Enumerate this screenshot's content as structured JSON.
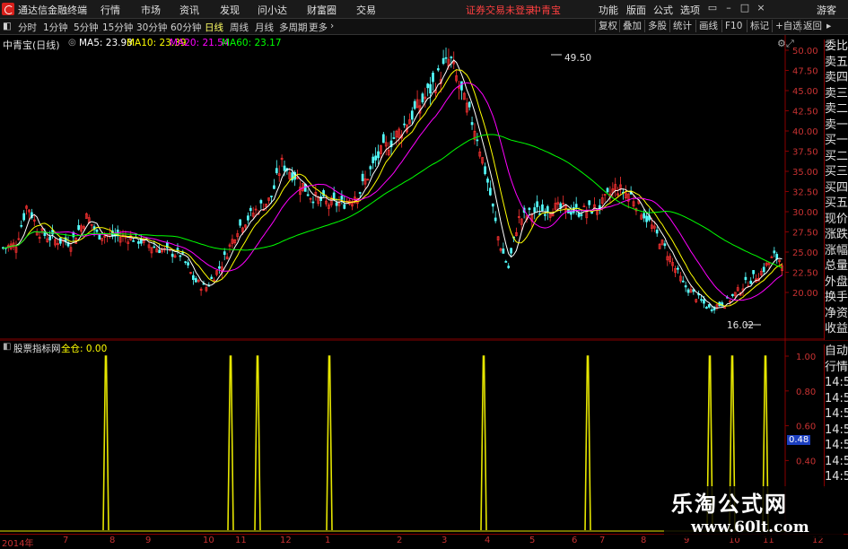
{
  "menubar": {
    "app_title": "通达信金融终端",
    "menus": [
      "行情",
      "市场",
      "资讯",
      "发现",
      "问小达",
      "财富圈",
      "交易"
    ],
    "login_notice": "证券交易未登录",
    "broker": "中青宝",
    "right_menus": [
      "功能",
      "版面",
      "公式",
      "选项"
    ],
    "guest": "游客"
  },
  "toolbar": {
    "periods": [
      "分时",
      "1分钟",
      "5分钟",
      "15分钟",
      "30分钟",
      "60分钟",
      "日线",
      "周线",
      "月线",
      "多周期",
      "更多"
    ],
    "active_period": "日线",
    "buttons": [
      "复权",
      "叠加",
      "多股",
      "统计",
      "画线",
      "F10",
      "标记",
      "+自选",
      "返回"
    ]
  },
  "main_chart": {
    "title": "中青宝(日线)",
    "ma_labels": [
      {
        "label": "MA5: 23.93",
        "color": "#ffffff"
      },
      {
        "label": "MA10: 23.39",
        "color": "#ffff00"
      },
      {
        "label": "MA20: 21.54",
        "color": "#ff00ff"
      },
      {
        "label": "MA60: 23.17",
        "color": "#00ff00"
      }
    ],
    "high_marker": "49.50",
    "low_marker": "16.02",
    "y_ticks": [
      "50.00",
      "47.50",
      "45.00",
      "42.50",
      "40.00",
      "37.50",
      "35.00",
      "32.50",
      "30.00",
      "27.50",
      "25.00",
      "22.50",
      "20.00"
    ]
  },
  "right_panel": [
    "委比",
    "卖五",
    "卖四",
    "卖三",
    "卖二",
    "卖一",
    "买一",
    "买二",
    "买三",
    "买四",
    "买五",
    "现价",
    "涨跌",
    "涨幅",
    "总量",
    "外盘",
    "换手",
    "净资",
    "收益"
  ],
  "right_panel2": [
    "自动",
    "行情",
    "14:5",
    "14:5",
    "14:5",
    "14:5",
    "14:5",
    "14:5",
    "14:5"
  ],
  "indicator": {
    "title": "股票指标网",
    "subtitle": "全仓: 0.00",
    "y_ticks": [
      "1.00",
      "0.80",
      "0.60",
      "0.40"
    ],
    "current_value": "0.48",
    "spike_dates_index": [
      26,
      57,
      64,
      81,
      119,
      145,
      176,
      181,
      190
    ]
  },
  "x_axis": [
    "2014年",
    "7",
    "8",
    "9",
    "10",
    "11",
    "12",
    "1",
    "2",
    "3",
    "4",
    "5",
    "6",
    "7",
    "8",
    "9",
    "10",
    "11",
    "12"
  ],
  "watermark": {
    "line1": "乐淘公式网",
    "line2": "www.60lt.com"
  },
  "colors": {
    "up": "#ff3232",
    "down": "#54ffff",
    "ma5": "#ffffff",
    "ma10": "#ffff00",
    "ma20": "#ff00ff",
    "ma60": "#00ff00",
    "grid": "#8a0000",
    "spike": "#e6e600"
  }
}
